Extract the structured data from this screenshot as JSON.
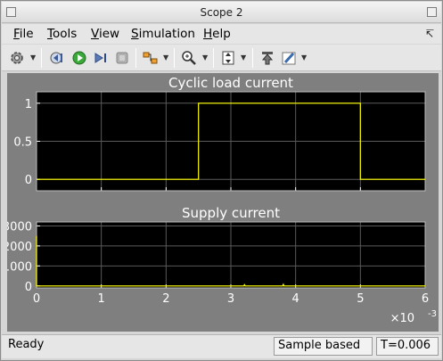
{
  "window": {
    "title": "Scope 2"
  },
  "menu": [
    {
      "label": "File",
      "ul": "F",
      "rest": "ile"
    },
    {
      "label": "Tools",
      "ul": "T",
      "rest": "ools"
    },
    {
      "label": "View",
      "ul": "V",
      "rest": "iew"
    },
    {
      "label": "Simulation",
      "ul": "S",
      "rest": "imulation"
    },
    {
      "label": "Help",
      "ul": "H",
      "rest": "elp"
    }
  ],
  "toolbar": {
    "icons": [
      "gear-icon",
      "step-back-icon",
      "run-icon",
      "step-forward-icon",
      "stop-icon",
      "signal-selector-icon",
      "zoom-icon",
      "fit-axes-icon",
      "highlight-block-icon",
      "style-pen-icon"
    ]
  },
  "colors": {
    "signal": "#ffff00",
    "plot_bg": "#000000",
    "grid": "#5a5a5a",
    "frame": "#7f7f7f"
  },
  "chart_data": [
    {
      "type": "line",
      "title": "Cyclic load current",
      "xlim": [
        0,
        0.006
      ],
      "ylim": [
        -0.15,
        1.15
      ],
      "yticks": [
        "0",
        "0.5",
        "1"
      ],
      "ytick_values": [
        0,
        0.5,
        1
      ],
      "xticks": [
        0,
        0.001,
        0.002,
        0.003,
        0.004,
        0.005,
        0.006
      ],
      "show_xtick_labels": false,
      "grid": true,
      "series": [
        {
          "x": [
            0,
            0.0025,
            0.0025,
            0.005,
            0.005,
            0.006
          ],
          "y": [
            0,
            0,
            1,
            1,
            0,
            0
          ]
        }
      ]
    },
    {
      "type": "line",
      "title": "Supply current",
      "xlim": [
        0,
        0.006
      ],
      "ylim": [
        -100,
        3200
      ],
      "yticks": [
        "0",
        "1000",
        "2000",
        "3000"
      ],
      "ytick_values": [
        0,
        1000,
        2000,
        3000
      ],
      "xticks": [
        0,
        0.001,
        0.002,
        0.003,
        0.004,
        0.005,
        0.006
      ],
      "xtick_labels": [
        "0",
        "1",
        "2",
        "3",
        "4",
        "5",
        "6"
      ],
      "show_xtick_labels": true,
      "x_multiplier": "×10",
      "x_multiplier_exp": "-3",
      "grid": true,
      "series": [
        {
          "x": [
            0,
            1e-07,
            2e-05,
            0.0032,
            0.00321,
            0.00322,
            0.0038,
            0.00381,
            0.00382,
            0.006
          ],
          "y": [
            2500,
            0,
            0,
            0,
            60,
            0,
            0,
            80,
            0,
            0
          ]
        }
      ]
    }
  ],
  "status": {
    "left": "Ready",
    "mode": "Sample based",
    "time": "T=0.006"
  }
}
